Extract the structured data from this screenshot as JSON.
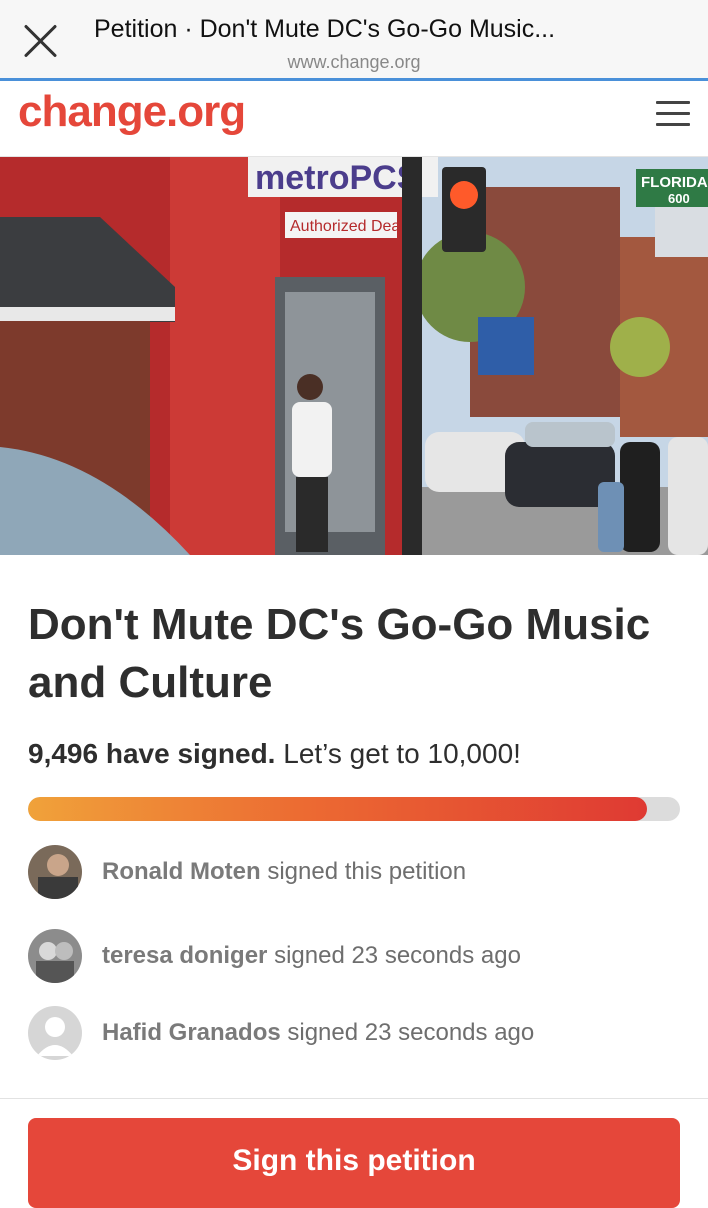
{
  "browser": {
    "tab_title": "Petition · Don't Mute DC's Go-Go Music...",
    "url": "www.change.org"
  },
  "site": {
    "logo": "change.org",
    "accent_color": "#e5473a"
  },
  "hero": {
    "store_sign": "metroPCS",
    "dealer_sign": "Authorized Dealer",
    "street_sign": "FLORIDA",
    "street_number": "600"
  },
  "petition": {
    "title": "Don't Mute DC's Go-Go Music and Culture",
    "signed_count": "9,496 have signed.",
    "goal_text": "Let’s get to 10,000!",
    "progress": 0.9496
  },
  "signers": [
    {
      "name": "Ronald Moten",
      "action": "signed this petition",
      "avatar": "photo"
    },
    {
      "name": "teresa doniger",
      "action": "signed 23 seconds ago",
      "avatar": "photo"
    },
    {
      "name": "Hafid Granados",
      "action": "signed 23 seconds ago",
      "avatar": "default-user-icon"
    }
  ],
  "cta": {
    "sign_label": "Sign this petition"
  }
}
